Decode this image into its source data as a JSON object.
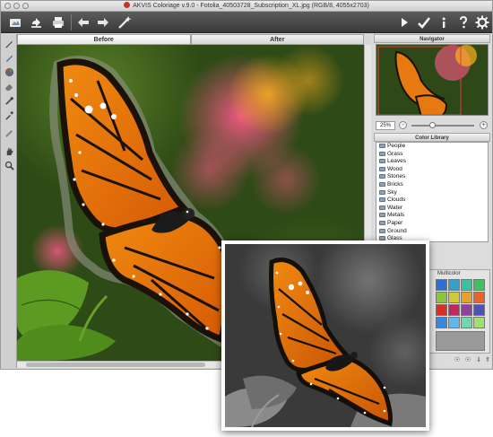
{
  "window": {
    "title": "AKVIS Coloriage v.9.0 - Fotolia_40503728_Subscription_XL.jpg (RGB/8, 4055x2703)"
  },
  "toolbar": {
    "left_icons": [
      "open-image-icon",
      "save-image-icon",
      "print-icon",
      "undo-icon",
      "redo-icon",
      "settings-wand-icon"
    ],
    "right_icons": [
      "run-icon",
      "apply-check-icon",
      "info-icon",
      "help-icon",
      "preferences-gear-icon"
    ]
  },
  "tabs": {
    "before_label": "Before",
    "after_label": "After",
    "active": "Before"
  },
  "left_tools": [
    "pencil-tool-icon",
    "keep-color-pencil-icon",
    "color-palette-icon",
    "eraser-icon",
    "magic-tube-icon",
    "eyedropper-icon",
    "chalk-icon",
    "hand-icon",
    "zoom-icon"
  ],
  "navigator": {
    "header": "Navigator",
    "zoom_value": "25%",
    "zoom_minus": "-",
    "zoom_plus": "+"
  },
  "color_library": {
    "header": "Color Library",
    "items": [
      "People",
      "Grass",
      "Leaves",
      "Wood",
      "Stones",
      "Bricks",
      "Sky",
      "Clouds",
      "Water",
      "Metals",
      "Paper",
      "Ground",
      "Glass"
    ]
  },
  "palette": {
    "label": "Multicolor",
    "colors_left": [
      "#e0147a",
      "#c83cb4",
      "#a050d0",
      "#7050e0",
      "#e85aa0",
      "#d070c8",
      "#a878e0",
      "#8070f0",
      "#f070b8",
      "#e090d8",
      "#c0a0f0",
      "#9c98f8",
      "#f8a0d0",
      "#f0b8e8",
      "#d8c4f8",
      "#c4c4ff"
    ],
    "colors_right": [
      "#2f6fd0",
      "#38a0c8",
      "#3cc0a0",
      "#40c060",
      "#8ec43c",
      "#d0c838",
      "#e8a030",
      "#e86428",
      "#d83028",
      "#c02860",
      "#9040a0",
      "#5050b8",
      "#3888e0",
      "#60b8e8",
      "#70d8b0",
      "#a0e070"
    ]
  },
  "bottom_icons": [
    "add-color-icon",
    "remove-color-icon",
    "import-icon",
    "export-icon"
  ],
  "after_card": {
    "description_icon": "colorized-butterfly-photo"
  }
}
